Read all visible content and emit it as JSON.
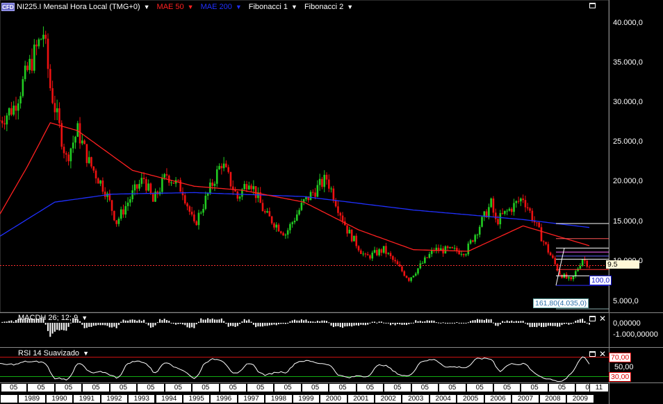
{
  "header": {
    "symbol_badge": "CFD",
    "symbol": "NI225.I Mensal Hora Local (TMG+0)",
    "indicators": [
      {
        "label": "MAE 50",
        "color": "#ff2020"
      },
      {
        "label": "MAE 200",
        "color": "#2020ff"
      },
      {
        "label": "Fibonacci 1",
        "color": "#ffffff"
      },
      {
        "label": "Fibonacci 2",
        "color": "#ffffff"
      }
    ]
  },
  "price_axis": {
    "ticks": [
      "40.000,0",
      "35.000,0",
      "30.000,0",
      "25.000,0",
      "20.000,0",
      "15.000,0",
      "10.000,0",
      "5.000,0"
    ],
    "current_label": "9.5",
    "fib_label_100": "100,0",
    "fib_label_161": "161,80(4.035,0)"
  },
  "macd": {
    "label": "MACDH 26; 12; 9",
    "ticks": [
      "0,00000",
      "-1.000,00000"
    ]
  },
  "rsi": {
    "label": "RSI 14 Suavizado",
    "ticks": [
      "70,00",
      "50,00",
      "30,00"
    ]
  },
  "time_axis": {
    "month_label": "05",
    "years": [
      "1989",
      "1990",
      "1991",
      "1992",
      "1993",
      "1994",
      "1995",
      "1996",
      "1997",
      "1998",
      "1999",
      "2000",
      "2001",
      "2002",
      "2003",
      "2004",
      "2005",
      "2006",
      "2007",
      "2008",
      "2009"
    ],
    "last_month_label": "11"
  },
  "colors": {
    "up": "#22cc22",
    "down": "#ee1111",
    "ma50": "#ff2020",
    "ma200": "#2030ff",
    "current_price_line": "#ff3030"
  },
  "chart_data": {
    "type": "candlestick",
    "instrument": "NI225.I",
    "period": "Mensal",
    "y_range": [
      3500,
      42500
    ],
    "x_range": [
      "1988-05",
      "2009-11"
    ],
    "close_path": [
      [
        "1988-05",
        27800
      ],
      [
        "1988-11",
        29500
      ],
      [
        "1989-05",
        34000
      ],
      [
        "1989-12",
        38900
      ],
      [
        "1990-03",
        32000
      ],
      [
        "1990-10",
        23000
      ],
      [
        "1991-03",
        26500
      ],
      [
        "1991-08",
        22500
      ],
      [
        "1992-03",
        19000
      ],
      [
        "1992-08",
        15000
      ],
      [
        "1993-03",
        18500
      ],
      [
        "1993-08",
        20500
      ],
      [
        "1993-12",
        17500
      ],
      [
        "1994-06",
        21000
      ],
      [
        "1995-01",
        19000
      ],
      [
        "1995-06",
        14500
      ],
      [
        "1996-06",
        22500
      ],
      [
        "1997-01",
        18000
      ],
      [
        "1997-06",
        20500
      ],
      [
        "1998-01",
        16000
      ],
      [
        "1998-10",
        13500
      ],
      [
        "1999-06",
        17500
      ],
      [
        "2000-04",
        20500
      ],
      [
        "2001-01",
        14000
      ],
      [
        "2001-09",
        10500
      ],
      [
        "2002-05",
        11500
      ],
      [
        "2003-04",
        7800
      ],
      [
        "2004-03",
        11500
      ],
      [
        "2005-05",
        11300
      ],
      [
        "2006-04",
        17300
      ],
      [
        "2006-06",
        15000
      ],
      [
        "2007-06",
        18100
      ],
      [
        "2008-03",
        12500
      ],
      [
        "2008-10",
        8500
      ],
      [
        "2009-03",
        7500
      ],
      [
        "2009-08",
        10400
      ],
      [
        "2009-11",
        9500
      ]
    ],
    "ma50_path": [
      [
        "1988-05",
        16000
      ],
      [
        "1989-05",
        22000
      ],
      [
        "1990-03",
        27500
      ],
      [
        "1991-03",
        26500
      ],
      [
        "1993-03",
        21500
      ],
      [
        "1995-06",
        19500
      ],
      [
        "1997-03",
        19000
      ],
      [
        "1999-06",
        17500
      ],
      [
        "2001-06",
        14000
      ],
      [
        "2003-06",
        11500
      ],
      [
        "2005-06",
        11300
      ],
      [
        "2007-06",
        14500
      ],
      [
        "2009-11",
        12000
      ]
    ],
    "ma200_path": [
      [
        "1988-05",
        13200
      ],
      [
        "1990-05",
        17500
      ],
      [
        "1992-06",
        18500
      ],
      [
        "1995-06",
        18700
      ],
      [
        "1999-06",
        18200
      ],
      [
        "2003-06",
        16500
      ],
      [
        "2007-06",
        15300
      ],
      [
        "2009-11",
        14300
      ]
    ],
    "current_price": 9500,
    "fibonacci_levels": [
      {
        "label": "100,0",
        "value": 7000
      },
      {
        "label": "161,80",
        "value": 4035
      }
    ],
    "macd_range": [
      -1500,
      700
    ],
    "rsi_levels": [
      70,
      50,
      30
    ]
  }
}
